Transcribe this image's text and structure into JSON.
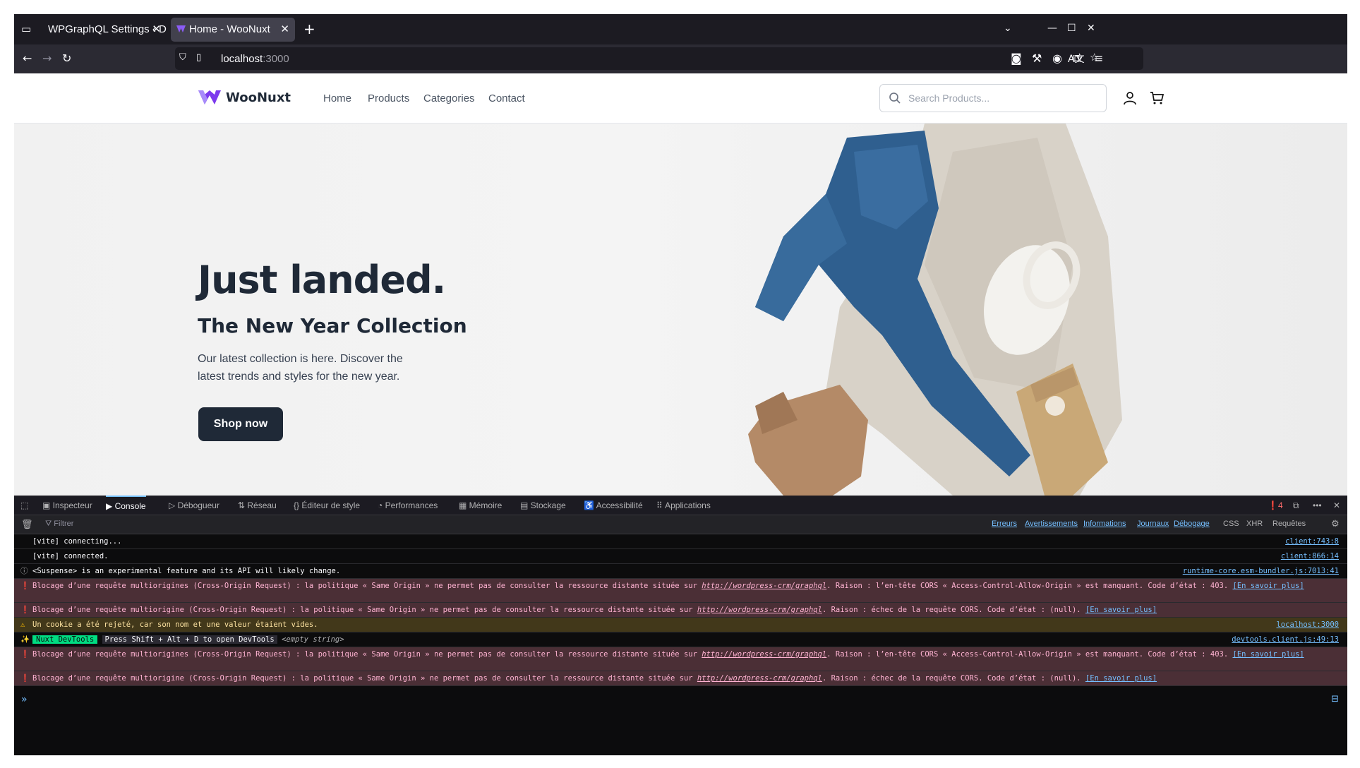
{
  "browser": {
    "tabs": [
      {
        "title": "WPGraphQL Settings ‹ Docke",
        "active": false
      },
      {
        "title": "Home - WooNuxt",
        "active": true
      }
    ],
    "url_host": "localhost",
    "url_port": ":3000"
  },
  "site": {
    "logo_text": "WooNuxt",
    "menu": [
      "Home",
      "Products",
      "Categories",
      "Contact"
    ],
    "search_placeholder": "Search Products...",
    "hero": {
      "title": "Just landed.",
      "subtitle": "The New Year Collection",
      "text": "Our latest collection is here. Discover the latest trends and styles for the new year.",
      "button": "Shop now"
    }
  },
  "devtools": {
    "tabs": [
      "Inspecteur",
      "Console",
      "Débogueur",
      "Réseau",
      "Éditeur de style",
      "Performances",
      "Mémoire",
      "Stockage",
      "Accessibilité",
      "Applications"
    ],
    "active_tab": "Console",
    "error_count": "4",
    "filter_placeholder": "Filtrer",
    "filters": [
      "Erreurs",
      "Avertissements",
      "Informations",
      "Journaux",
      "Débogage"
    ],
    "filters_plain": [
      "CSS",
      "XHR",
      "Requêtes"
    ],
    "messages": [
      {
        "type": "log",
        "text": "[vite] connecting...",
        "source": "client:743:8"
      },
      {
        "type": "log",
        "text": "[vite] connected.",
        "source": "client:866:14"
      },
      {
        "type": "info",
        "text": "<Suspense> is an experimental feature and its API will likely change.",
        "source": "runtime-core.esm-bundler.js:7013:41"
      },
      {
        "type": "error",
        "text": "Blocage d’une requête multiorigines (Cross-Origin Request) : la politique « Same Origin » ne permet pas de consulter la ressource distante située sur ",
        "link": "http://wordpress-crm/graphql",
        "text2": ". Raison : l’en-tête CORS « Access-Control-Allow-Origin » est manquant. Code d’état : 403. ",
        "more": "[En savoir plus]"
      },
      {
        "type": "error",
        "text": "Blocage d’une requête multiorigine (Cross-Origin Request) : la politique « Same Origin » ne permet pas de consulter la ressource distante située sur ",
        "link": "http://wordpress-crm/graphql",
        "text2": ". Raison : échec de la requête CORS. Code d’état : (null). ",
        "more": "[En savoir plus]"
      },
      {
        "type": "warn",
        "text": "Un cookie a été rejeté, car son nom et une valeur étaient vides.",
        "source": "localhost:3000"
      },
      {
        "type": "nuxt",
        "badge": "Nuxt DevTools",
        "key": "Press Shift + Alt + D to open DevTools",
        "extra": "<empty string>",
        "source": "devtools.client.js:49:13"
      },
      {
        "type": "error",
        "text": "Blocage d’une requête multiorigines (Cross-Origin Request) : la politique « Same Origin » ne permet pas de consulter la ressource distante située sur ",
        "link": "http://wordpress-crm/graphql",
        "text2": ". Raison : l’en-tête CORS « Access-Control-Allow-Origin » est manquant. Code d’état : 403. ",
        "more": "[En savoir plus]"
      },
      {
        "type": "error",
        "text": "Blocage d’une requête multiorigine (Cross-Origin Request) : la politique « Same Origin » ne permet pas de consulter la ressource distante située sur ",
        "link": "http://wordpress-crm/graphql",
        "text2": ". Raison : échec de la requête CORS. Code d’état : (null). ",
        "more": "[En savoir plus]"
      }
    ]
  },
  "colors": {
    "accent": "#75bfff",
    "brand": "#7c3aed",
    "dark_button": "#1f2937"
  }
}
